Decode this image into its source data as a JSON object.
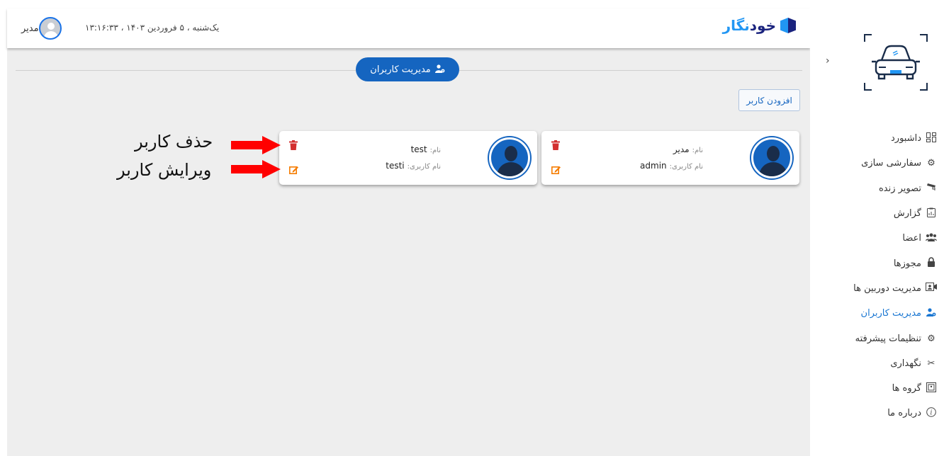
{
  "header": {
    "user_name": "مدیر",
    "datetime": "یک‌شنبه ، ۵ فروردین ۱۴۰۳ ، ۱۳:۱۶:۳۳",
    "logo_main": "خود",
    "logo_accent": "نگار"
  },
  "page": {
    "title": "مدیریت کاربران",
    "add_user_label": "افزودن کاربر"
  },
  "users": [
    {
      "name_key": "نام:",
      "name": "مدیر",
      "username_key": "نام کاربری:",
      "username": "admin"
    },
    {
      "name_key": "نام:",
      "name": "test",
      "username_key": "نام کاربری:",
      "username": "testi"
    }
  ],
  "annotations": {
    "delete": "حذف کاربر",
    "edit": "ویرایش کاربر"
  },
  "sidebar": {
    "items": [
      {
        "label": "داشبورد",
        "icon": "dashboard-icon"
      },
      {
        "label": "سفارشی سازی",
        "icon": "gear-icon"
      },
      {
        "label": "تصویر زنده",
        "icon": "cctv-icon"
      },
      {
        "label": "گزارش",
        "icon": "report-icon"
      },
      {
        "label": "اعضا",
        "icon": "members-icon"
      },
      {
        "label": "مجوزها",
        "icon": "lock-icon"
      },
      {
        "label": "مدیریت دوربین ها",
        "icon": "camera-icon"
      },
      {
        "label": "مدیریت کاربران",
        "icon": "user-gear-icon",
        "active": true
      },
      {
        "label": "تنظیمات پیشرفته",
        "icon": "advanced-gear-icon"
      },
      {
        "label": "نگهداری",
        "icon": "tools-icon"
      },
      {
        "label": "گروه ها",
        "icon": "group-icon"
      },
      {
        "label": "درباره ما",
        "icon": "info-icon"
      }
    ]
  },
  "colors": {
    "primary": "#1565c0",
    "active": "#1976d2",
    "delete": "#d32f2f",
    "edit": "#f57c00",
    "annotation_arrow": "#ff0000"
  }
}
